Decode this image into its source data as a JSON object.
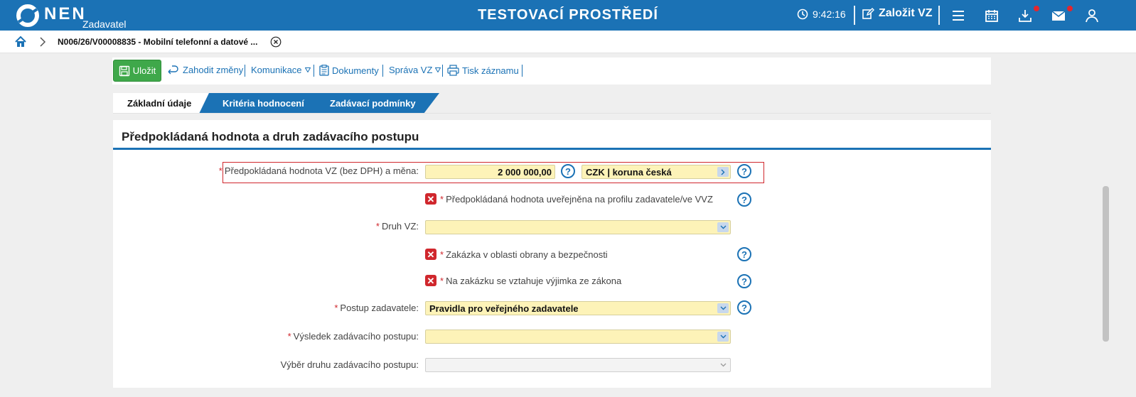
{
  "header": {
    "logo_text": "NEN",
    "logo_sub": "Zadavatel",
    "env_title": "TESTOVACÍ PROSTŘEDÍ",
    "time": "9:42:16",
    "create_label": "Založit VZ"
  },
  "breadcrumb": {
    "current": "N006/26/V00008835 - Mobilní telefonní a datové ..."
  },
  "toolbar": {
    "save": "Uložit",
    "discard": "Zahodit změny",
    "communication": "Komunikace",
    "documents": "Dokumenty",
    "manage": "Správa VZ",
    "print": "Tisk záznamu"
  },
  "tabs": [
    "Základní údaje",
    "Kritéria hodnocení",
    "Zadávací podmínky"
  ],
  "section": {
    "title": "Předpokládaná hodnota a druh zadávacího postupu"
  },
  "form": {
    "estimated_value_label": "Předpokládaná hodnota VZ (bez DPH) a měna:",
    "estimated_value": "2 000 000,00",
    "currency": "CZK | koruna česká",
    "published_label": "Předpokládaná hodnota uveřejněna na profilu zadavatele/ve VVZ",
    "type_label": "Druh VZ:",
    "type_value": "",
    "defense_label": "Zakázka v oblasti obrany a bezpečnosti",
    "exception_label": "Na zakázku se vztahuje výjimka ze zákona",
    "procedure_label": "Postup zadavatele:",
    "procedure_value": "Pravidla pro veřejného zadavatele",
    "result_label": "Výsledek zadávacího postupu:",
    "result_value": "",
    "selection_label": "Výběr druhu zadávacího postupu:",
    "selection_value": "",
    "required_mark": "*",
    "help_mark": "?",
    "unchecked_mark": "✕"
  },
  "colors": {
    "brand": "#1b72b5",
    "save": "#3fa84a",
    "required": "#d0272d",
    "field": "#fdf3b8"
  }
}
